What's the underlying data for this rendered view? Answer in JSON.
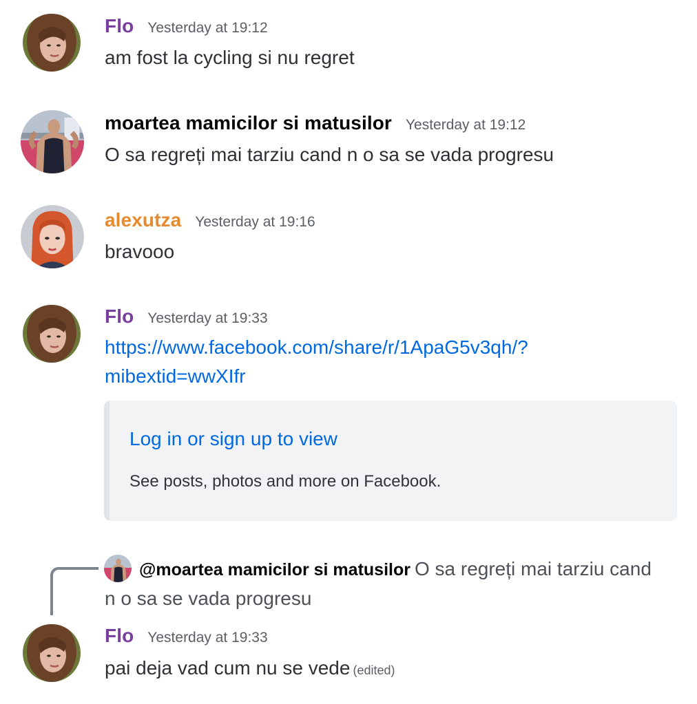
{
  "colors": {
    "flo": "#7a3f9e",
    "moartea": "#060607",
    "alexutza": "#e68a2e",
    "link": "#0068e0"
  },
  "messages": [
    {
      "author": "Flo",
      "timestamp": "Yesterday at 19:12",
      "text": "am fost la cycling si nu regret"
    },
    {
      "author": "moartea mamicilor si matusilor",
      "timestamp": "Yesterday at 19:12",
      "text": "O sa regreți mai tarziu cand n o sa se vada progresu"
    },
    {
      "author": "alexutza",
      "timestamp": "Yesterday at 19:16",
      "text": "bravooo"
    },
    {
      "author": "Flo",
      "timestamp": "Yesterday at 19:33",
      "link_line1": "https://www.facebook.com/share/r/1ApaG5v3qh/?",
      "link_line2": "mibextid=wwXIfr",
      "embed": {
        "title": "Log in or sign up to view",
        "description": "See posts, photos and more on Facebook."
      }
    },
    {
      "reply": {
        "author": "@moartea mamicilor si matusilor",
        "text": "O sa regreți mai tarziu cand n o sa se vada progresu"
      },
      "author": "Flo",
      "timestamp": "Yesterday at 19:33",
      "text": "pai deja vad cum nu se vede",
      "edited": "(edited)"
    }
  ]
}
